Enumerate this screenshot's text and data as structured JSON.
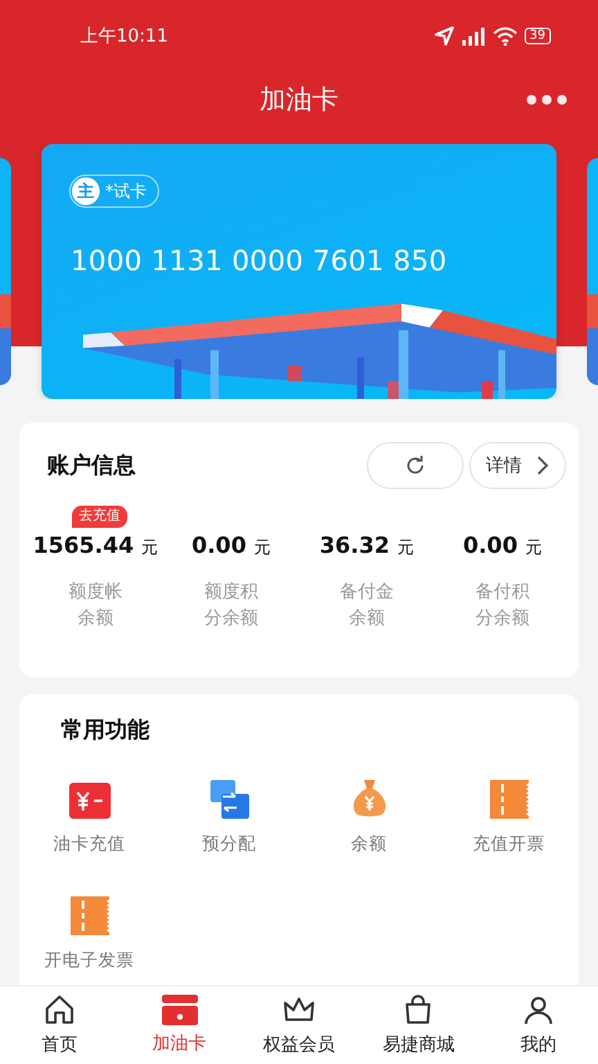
{
  "status_bar": {
    "time": "上午10:11",
    "battery": "39"
  },
  "header": {
    "title": "加油卡"
  },
  "card": {
    "badge": "主",
    "name": "*试卡",
    "number": "1000 1131 0000 7601 850"
  },
  "account": {
    "title": "账户信息",
    "details": "详情",
    "balances": [
      {
        "amount": "1565.44",
        "unit": "元",
        "label": "额度帐余额",
        "tag": "去充值"
      },
      {
        "amount": "0.00",
        "unit": "元",
        "label": "额度积分余额"
      },
      {
        "amount": "36.32",
        "unit": "元",
        "label": "备付金余额"
      },
      {
        "amount": "0.00",
        "unit": "元",
        "label": "备付积分余额"
      }
    ]
  },
  "functions": {
    "title": "常用功能",
    "items": [
      {
        "label": "油卡充值",
        "kind": "recharge"
      },
      {
        "label": "预分配",
        "kind": "allocate"
      },
      {
        "label": "余额",
        "kind": "moneybag"
      },
      {
        "label": "充值开票",
        "kind": "ticket"
      },
      {
        "label": "开电子发票",
        "kind": "ticket"
      }
    ]
  },
  "tabs": [
    {
      "label": "首页",
      "kind": "home",
      "selected": false
    },
    {
      "label": "加油卡",
      "kind": "card",
      "selected": true
    },
    {
      "label": "权益会员",
      "kind": "member",
      "selected": false
    },
    {
      "label": "易捷商城",
      "kind": "shop",
      "selected": false
    },
    {
      "label": "我的",
      "kind": "me",
      "selected": false
    }
  ]
}
